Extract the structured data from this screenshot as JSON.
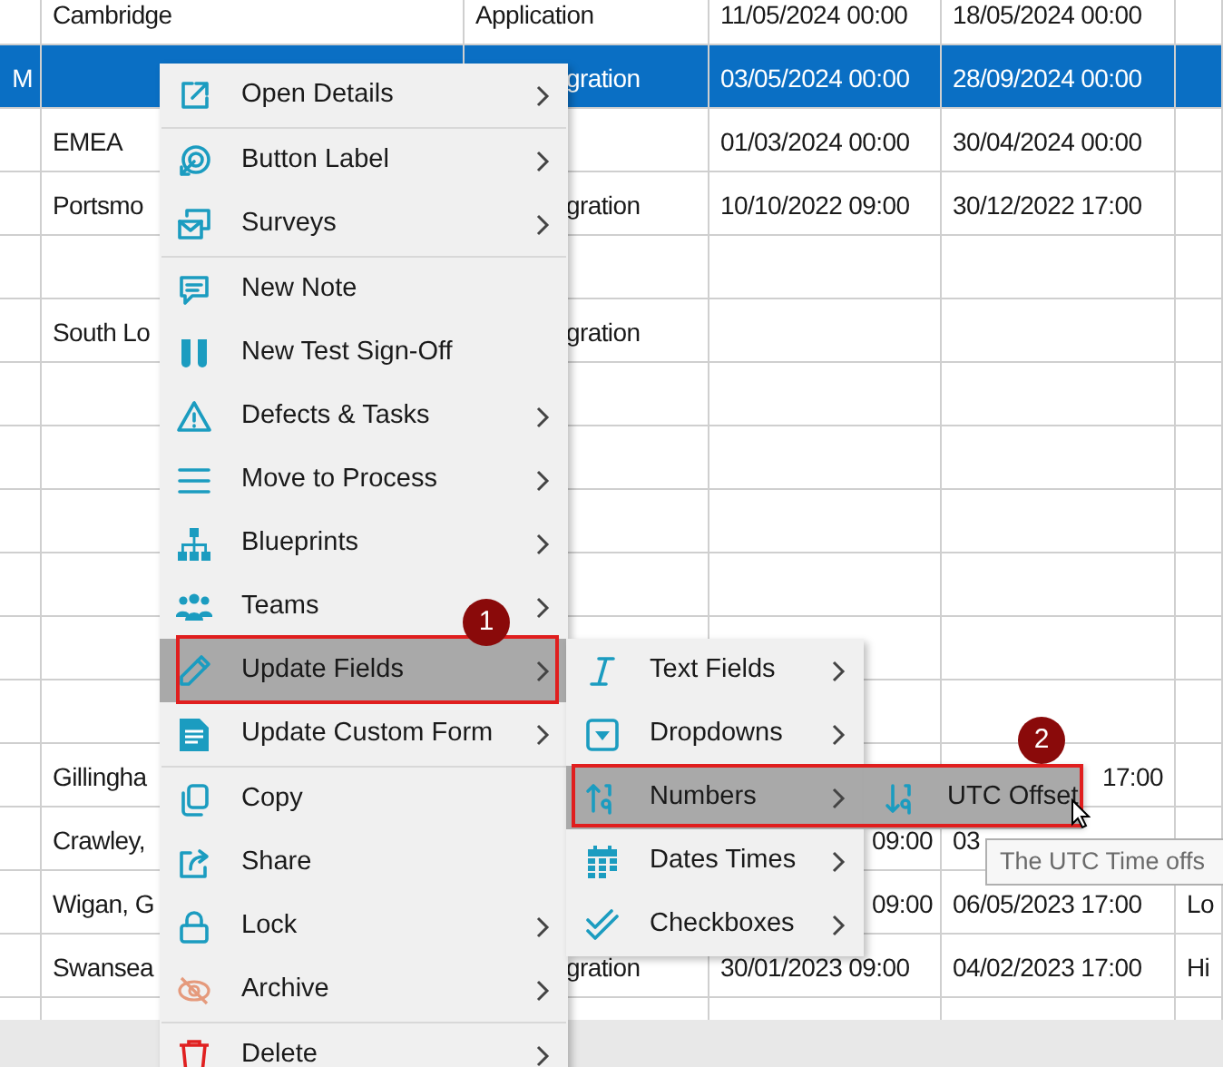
{
  "table": {
    "rows": [
      {
        "selected": false,
        "cells": [
          "",
          "Cambridge",
          "Application",
          "11/05/2024 00:00",
          "18/05/2024 00:00",
          ""
        ]
      },
      {
        "selected": true,
        "cells": [
          "M",
          "",
          "gration",
          "03/05/2024 00:00",
          "28/09/2024 00:00",
          ""
        ]
      },
      {
        "selected": false,
        "cells": [
          "",
          "EMEA",
          "",
          "01/03/2024 00:00",
          "30/04/2024 00:00",
          ""
        ]
      },
      {
        "selected": false,
        "cells": [
          "",
          "Portsmo",
          "gration",
          "10/10/2022 09:00",
          "30/12/2022 17:00",
          ""
        ]
      },
      {
        "selected": false,
        "cells": [
          "",
          "",
          "",
          "",
          "",
          ""
        ]
      },
      {
        "selected": false,
        "cells": [
          "",
          "South Lo",
          "gration",
          "",
          "",
          ""
        ]
      },
      {
        "selected": false,
        "cells": [
          "",
          "",
          "",
          "",
          "",
          ""
        ]
      },
      {
        "selected": false,
        "cells": [
          "",
          "",
          "",
          "",
          "",
          ""
        ]
      },
      {
        "selected": false,
        "cells": [
          "",
          "",
          "",
          "",
          "",
          ""
        ]
      },
      {
        "selected": false,
        "cells": [
          "",
          "",
          "",
          "",
          "",
          ""
        ]
      },
      {
        "selected": false,
        "cells": [
          "",
          "",
          "",
          "",
          "",
          ""
        ]
      },
      {
        "selected": false,
        "cells": [
          "",
          "",
          "",
          "",
          "",
          ""
        ]
      },
      {
        "selected": false,
        "cells": [
          "",
          "Gillingha",
          "",
          "",
          "17:00",
          ""
        ]
      },
      {
        "selected": false,
        "cells": [
          "",
          "Crawley,",
          "",
          "09:00",
          "03",
          ""
        ]
      },
      {
        "selected": false,
        "cells": [
          "",
          "Wigan, G",
          "",
          "09:00",
          "06/05/2023 17:00",
          "Lo"
        ]
      },
      {
        "selected": false,
        "cells": [
          "",
          "Swansea",
          "gration",
          "30/01/2023 09:00",
          "04/02/2023 17:00",
          "Hi"
        ]
      },
      {
        "selected": false,
        "cells": [
          "",
          "",
          "",
          "",
          "",
          ""
        ]
      }
    ]
  },
  "context_menu": {
    "items": [
      {
        "kind": "item",
        "label": "Open Details",
        "submenu": true,
        "highlighted": false
      },
      {
        "kind": "separator"
      },
      {
        "kind": "item",
        "label": "Button Label",
        "submenu": true,
        "highlighted": false
      },
      {
        "kind": "item",
        "label": "Surveys",
        "submenu": true,
        "highlighted": false
      },
      {
        "kind": "separator"
      },
      {
        "kind": "item",
        "label": "New Note",
        "submenu": false,
        "highlighted": false
      },
      {
        "kind": "item",
        "label": "New Test Sign-Off",
        "submenu": false,
        "highlighted": false
      },
      {
        "kind": "item",
        "label": "Defects & Tasks",
        "submenu": true,
        "highlighted": false
      },
      {
        "kind": "item",
        "label": "Move to Process",
        "submenu": true,
        "highlighted": false
      },
      {
        "kind": "item",
        "label": "Blueprints",
        "submenu": true,
        "highlighted": false
      },
      {
        "kind": "item",
        "label": "Teams",
        "submenu": true,
        "highlighted": false
      },
      {
        "kind": "item",
        "label": "Update Fields",
        "submenu": true,
        "highlighted": true
      },
      {
        "kind": "item",
        "label": "Update Custom Form",
        "submenu": true,
        "highlighted": false
      },
      {
        "kind": "separator"
      },
      {
        "kind": "item",
        "label": "Copy",
        "submenu": false,
        "highlighted": false
      },
      {
        "kind": "item",
        "label": "Share",
        "submenu": false,
        "highlighted": false
      },
      {
        "kind": "item",
        "label": "Lock",
        "submenu": true,
        "highlighted": false
      },
      {
        "kind": "item",
        "label": "Archive",
        "submenu": true,
        "highlighted": false
      },
      {
        "kind": "separator"
      },
      {
        "kind": "item",
        "label": "Delete",
        "submenu": true,
        "highlighted": false
      }
    ]
  },
  "update_fields_submenu": {
    "items": [
      {
        "label": "Text Fields",
        "submenu": true,
        "highlighted": false
      },
      {
        "label": "Dropdowns",
        "submenu": true,
        "highlighted": false
      },
      {
        "label": "Numbers",
        "submenu": true,
        "highlighted": true
      },
      {
        "label": "Dates Times",
        "submenu": true,
        "highlighted": false
      },
      {
        "label": "Checkboxes",
        "submenu": true,
        "highlighted": false
      }
    ]
  },
  "numbers_submenu": {
    "items": [
      {
        "label": "UTC Offset",
        "highlighted": true
      }
    ]
  },
  "tooltip": {
    "text": "The UTC Time offs"
  },
  "callouts": [
    {
      "number": "1"
    },
    {
      "number": "2"
    }
  ]
}
